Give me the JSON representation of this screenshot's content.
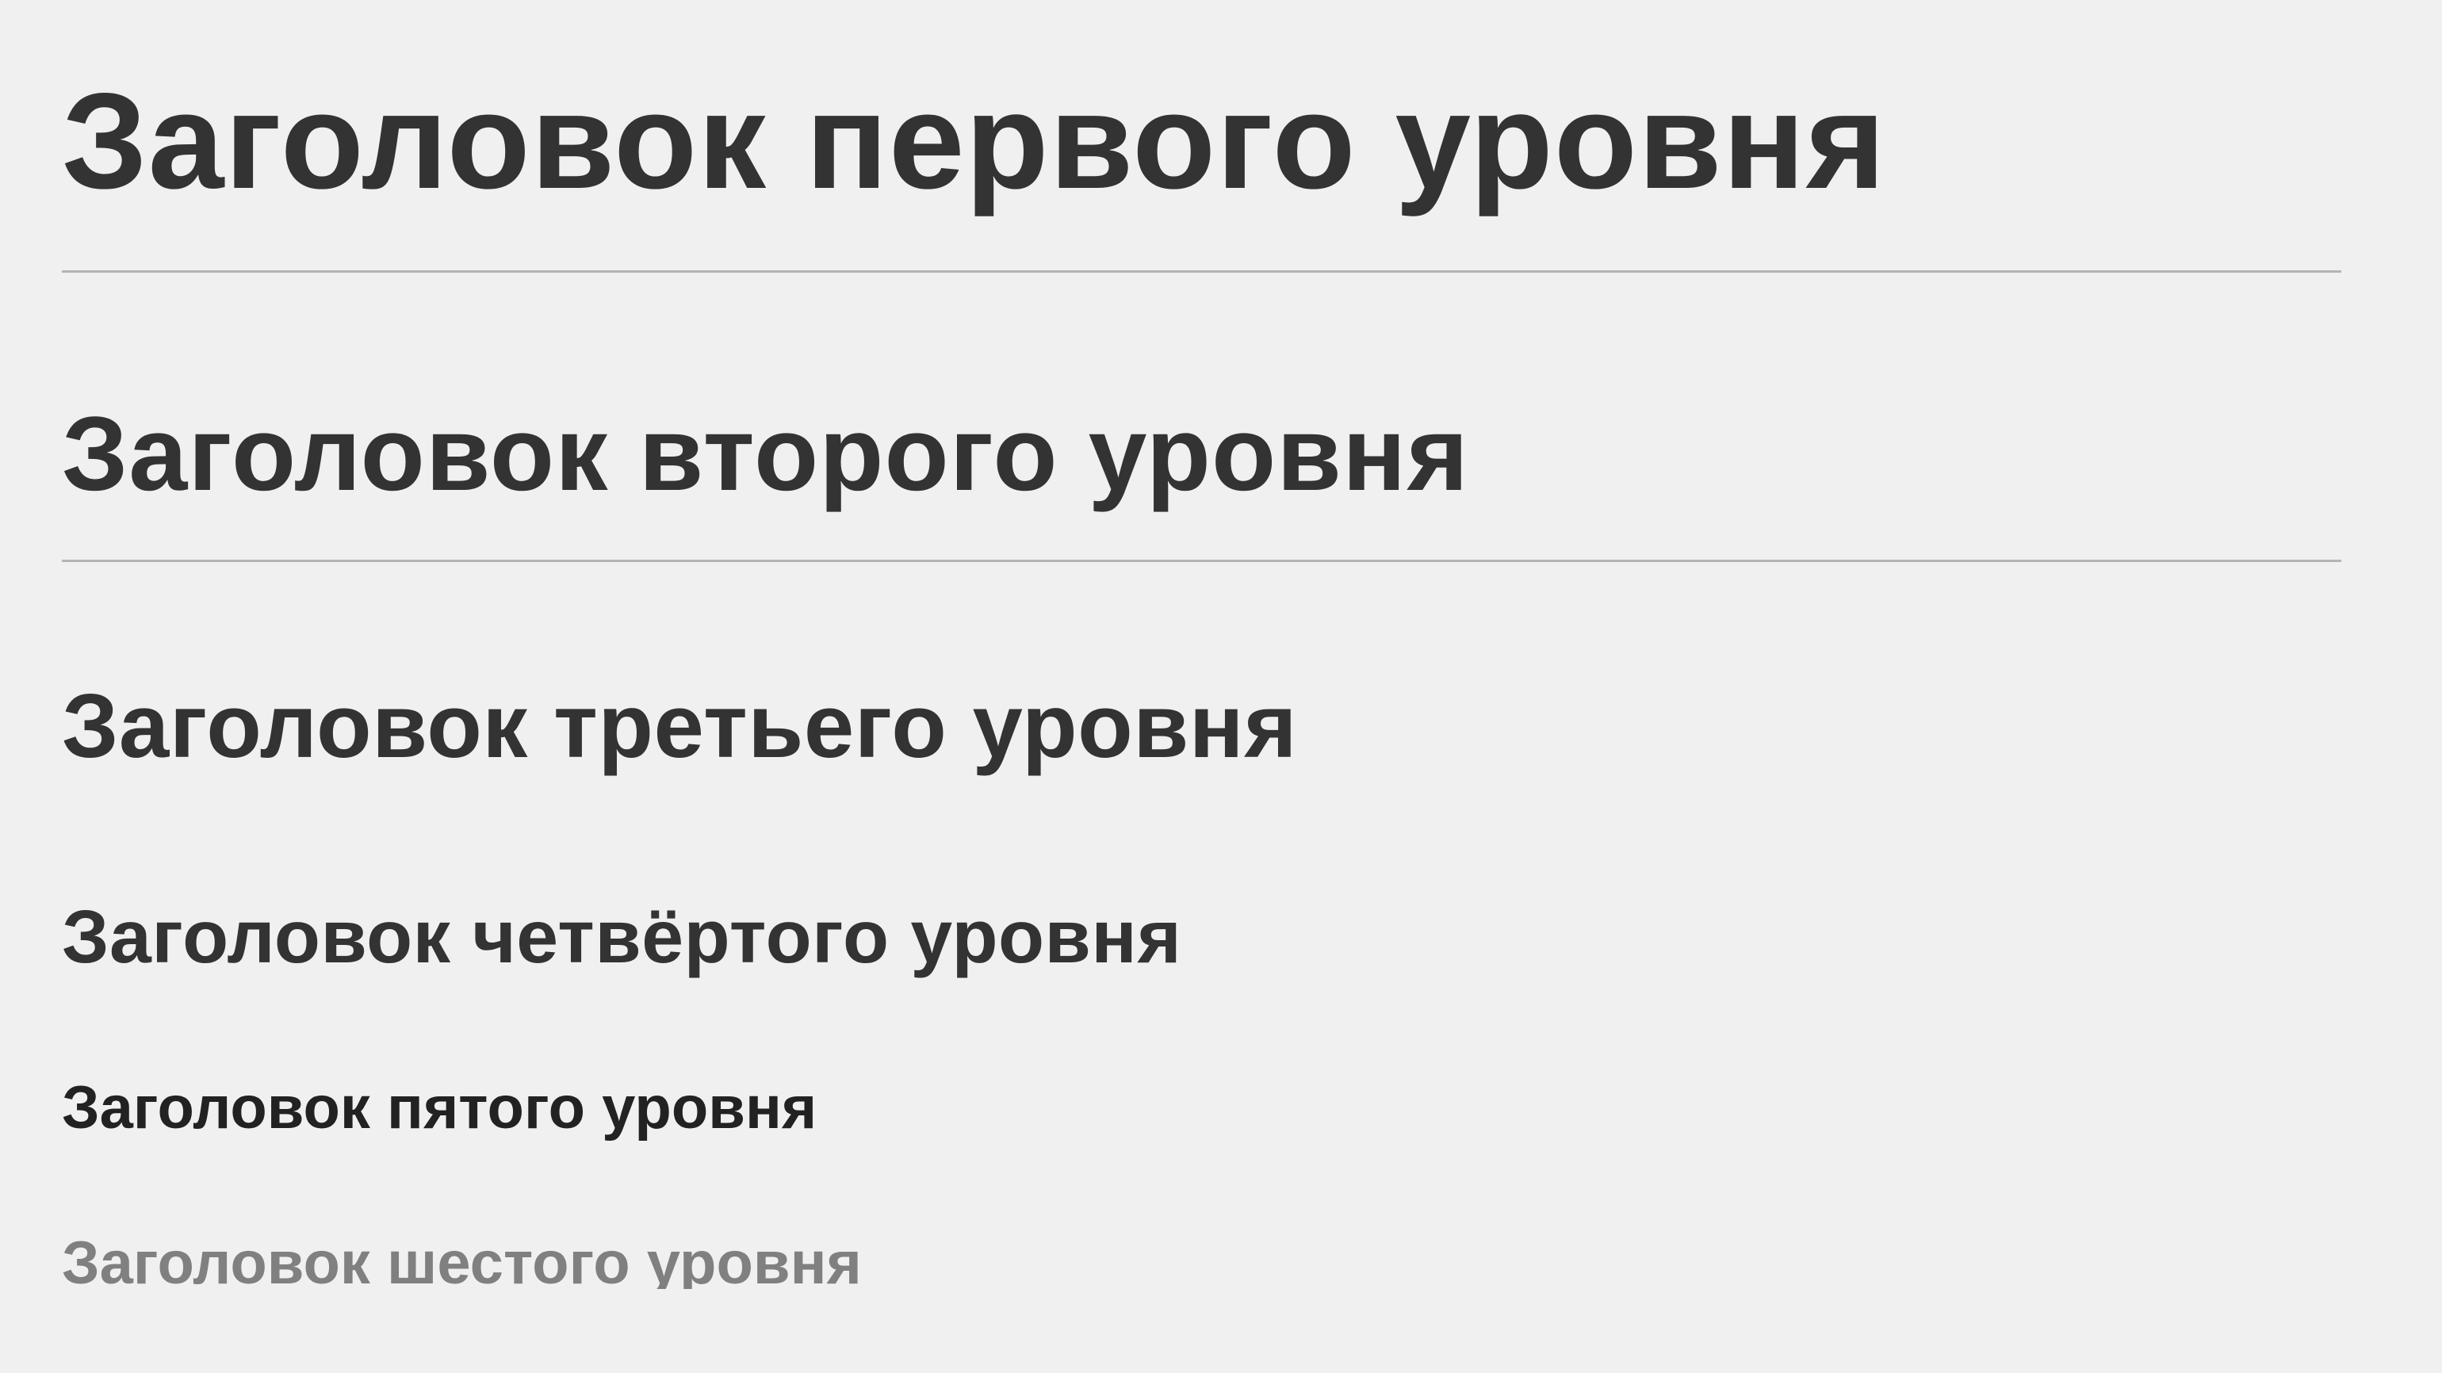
{
  "headings": {
    "h1": "Заголовок первого уровня",
    "h2": "Заголовок второго уровня",
    "h3": "Заголовок третьего уровня",
    "h4": "Заголовок четвёртого уровня",
    "h5": "Заголовок пятого уровня",
    "h6": "Заголовок шестого уровня"
  },
  "colors": {
    "background": "#f0f0f0",
    "heading_text": "#333333",
    "h6_text": "#808080",
    "rule": "#b4b4b4"
  }
}
